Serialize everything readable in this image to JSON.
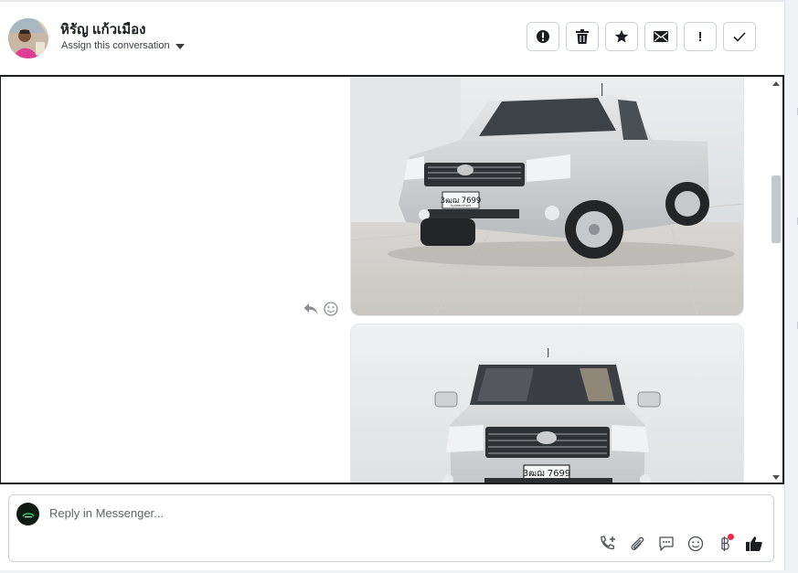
{
  "header": {
    "contact_name": "หิรัญ แก้วเมือง",
    "assign_label": "Assign this conversation",
    "actions": [
      {
        "name": "mark-spam-button",
        "icon": "alert-circle-icon"
      },
      {
        "name": "delete-button",
        "icon": "trash-icon"
      },
      {
        "name": "star-button",
        "icon": "star-icon"
      },
      {
        "name": "mark-unread-button",
        "icon": "envelope-icon"
      },
      {
        "name": "follow-up-button",
        "icon": "exclamation-icon",
        "text": "!"
      },
      {
        "name": "mark-done-button",
        "icon": "check-icon"
      }
    ]
  },
  "messages": {
    "photos": [
      {
        "plate_text": "3ฒฌ 7699",
        "plate_sub": "กรุงเทพมหานคร",
        "view": "three-quarter"
      },
      {
        "plate_text": "3ฒฌ 7699",
        "plate_sub": "กรุงเทพมหานคร",
        "view": "front"
      }
    ],
    "tools": [
      "reply-icon",
      "emoji-icon"
    ]
  },
  "composer": {
    "placeholder": "Reply in Messenger...",
    "value": "",
    "tools": [
      "call-add-icon",
      "paperclip-icon",
      "saved-replies-icon",
      "emoji-icon",
      "baht-icon",
      "thumbs-up-icon"
    ]
  },
  "colors": {
    "accent": "#1c1e21",
    "notification_dot": "#f02849",
    "border": "#ccd0d5"
  }
}
